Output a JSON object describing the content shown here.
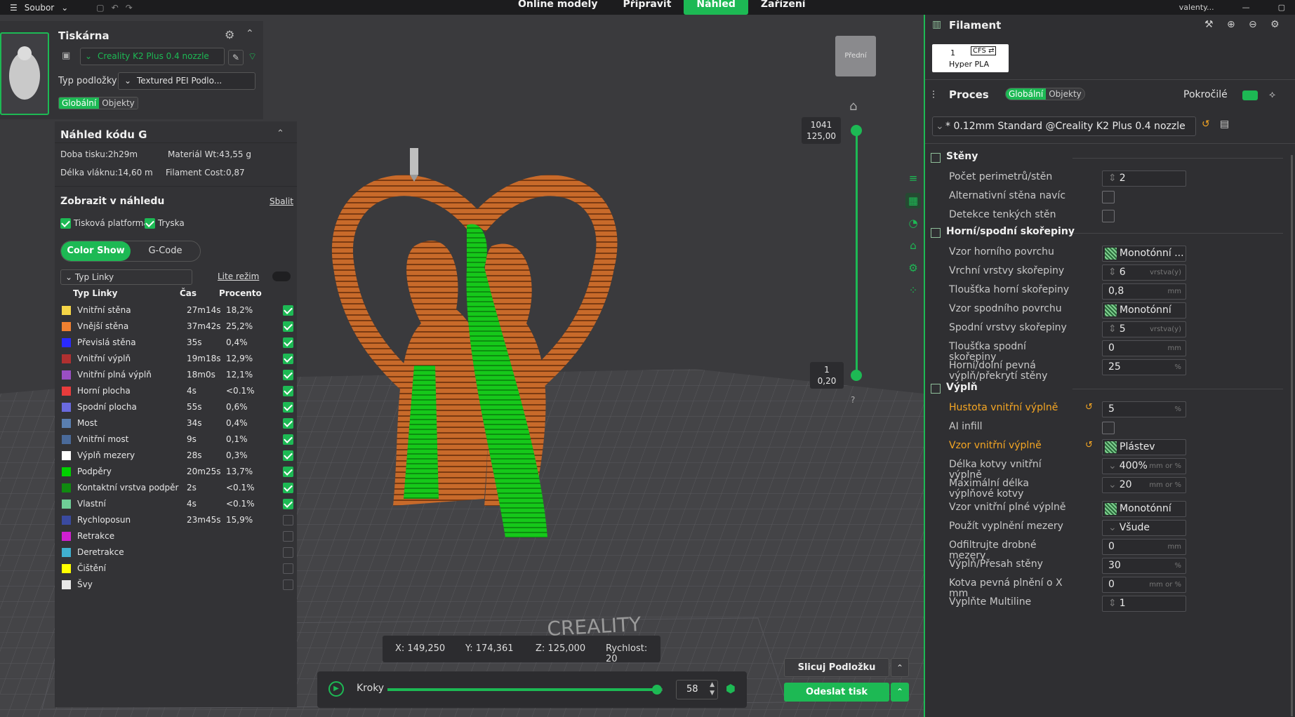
{
  "topbar": {
    "menu_label": "Soubor",
    "tabs": [
      "Online modely",
      "Připravit",
      "Náhled",
      "Zařízení"
    ],
    "active_tab": "Náhled",
    "user": "valenty..."
  },
  "printer": {
    "title": "Tiskárna",
    "printer_name": "Creality K2 Plus 0.4 nozzle",
    "bed_type_label": "Typ podložky",
    "bed_type_value": "Textured PEI Podlo...",
    "scope_global": "Globální",
    "scope_objects": "Objekty"
  },
  "gcode_preview": {
    "title": "Náhled kódu G",
    "print_time": "Doba tisku:2h29m",
    "material_weight": "Materiál Wt:43,55 g",
    "filament_length": "Délka vláknu:14,60 m",
    "filament_cost": "Filament Cost:0,87",
    "show_title": "Zobrazit v náhledu",
    "collapse": "Sbalit",
    "show_platform": "Tisková platforma",
    "show_nozzle": "Tryska",
    "mode_color_show": "Color Show",
    "mode_gcode": "G-Code",
    "line_type_select": "Typ Linky",
    "lite_mode": "Lite režim",
    "col_type": "Typ Linky",
    "col_time": "Čas",
    "col_percent": "Procento",
    "rows": [
      {
        "name": "Vnitřní stěna",
        "time": "27m14s",
        "percent": "18,2%",
        "color": "#f5d547",
        "checked": true
      },
      {
        "name": "Vnější stěna",
        "time": "37m42s",
        "percent": "25,2%",
        "color": "#f08030",
        "checked": true
      },
      {
        "name": "Převislá stěna",
        "time": "35s",
        "percent": "0,4%",
        "color": "#2a2aff",
        "checked": true
      },
      {
        "name": "Vnitřní výplň",
        "time": "19m18s",
        "percent": "12,9%",
        "color": "#b03030",
        "checked": true
      },
      {
        "name": "Vnitřní plná výplň",
        "time": "18m0s",
        "percent": "12,1%",
        "color": "#9a4fc4",
        "checked": true
      },
      {
        "name": "Horní plocha",
        "time": "4s",
        "percent": "<0.1%",
        "color": "#e83c3c",
        "checked": true
      },
      {
        "name": "Spodní plocha",
        "time": "55s",
        "percent": "0,6%",
        "color": "#6a6adf",
        "checked": true
      },
      {
        "name": "Most",
        "time": "34s",
        "percent": "0,4%",
        "color": "#5a7fb0",
        "checked": true
      },
      {
        "name": "Vnitřní most",
        "time": "9s",
        "percent": "0,1%",
        "color": "#4a6a9a",
        "checked": true
      },
      {
        "name": "Výplň mezery",
        "time": "28s",
        "percent": "0,3%",
        "color": "#ffffff",
        "checked": true
      },
      {
        "name": "Podpěry",
        "time": "20m25s",
        "percent": "13,7%",
        "color": "#00d000",
        "checked": true
      },
      {
        "name": "Kontaktní vrstva podpěr",
        "time": "2s",
        "percent": "<0.1%",
        "color": "#108a10",
        "checked": true
      },
      {
        "name": "Vlastní",
        "time": "4s",
        "percent": "<0.1%",
        "color": "#6fcf97",
        "checked": true
      },
      {
        "name": "Rychloposun",
        "time": "23m45s",
        "percent": "15,9%",
        "color": "#3a4aa0",
        "checked": false
      },
      {
        "name": "Retrakce",
        "time": "",
        "percent": "",
        "color": "#d020d0",
        "checked": false
      },
      {
        "name": "Deretrakce",
        "time": "",
        "percent": "",
        "color": "#40b0d0",
        "checked": false
      },
      {
        "name": "Čištění",
        "time": "",
        "percent": "",
        "color": "#ffff00",
        "checked": false
      },
      {
        "name": "Švy",
        "time": "",
        "percent": "",
        "color": "#e8e8e8",
        "checked": false
      }
    ]
  },
  "viewport": {
    "view_cube_label": "Přední",
    "layer_top_a": "1041",
    "layer_top_b": "125,00",
    "layer_bottom_a": "1",
    "layer_bottom_b": "0,20",
    "help": "?",
    "coords": {
      "x": "X: 149,250",
      "y": "Y: 174,361",
      "z": "Z: 125,000",
      "speed": "Rychlost: 20"
    },
    "steps_label": "Kroky",
    "steps_value": "58",
    "steps_fraction": 0.98,
    "slice_plate": "Slicuj Podložku",
    "send_print": "Odeslat tisk"
  },
  "filament": {
    "title": "Filament",
    "slot": "1",
    "cfs_label": "CFS",
    "material": "Hyper PLA"
  },
  "process": {
    "title": "Proces",
    "scope_global": "Globální",
    "scope_objects": "Objekty",
    "advanced": "Pokročilé",
    "preset": "* 0.12mm Standard @Creality K2 Plus 0.4 nozzle",
    "sections": {
      "walls": "Stěny",
      "shells": "Horní/spodní skořepiny",
      "infill": "Výplň"
    },
    "walls_rows": [
      {
        "label": "Počet perimetrů/stěn",
        "type": "spin",
        "value": "2",
        "unit": ""
      },
      {
        "label": "Alternativní stěna navíc",
        "type": "check"
      },
      {
        "label": "Detekce tenkých stěn",
        "type": "check"
      }
    ],
    "shell_rows": [
      {
        "label": "Vzor horního povrchu",
        "type": "pattern",
        "value": "Monotónní ..."
      },
      {
        "label": "Vrchní vrstvy skořepiny",
        "type": "spin",
        "value": "6",
        "unit": "vrstva(y)"
      },
      {
        "label": "Tloušťka horní skořepiny",
        "type": "text",
        "value": "0,8",
        "unit": "mm"
      },
      {
        "label": "Vzor spodního povrchu",
        "type": "pattern",
        "value": "Monotónní"
      },
      {
        "label": "Spodní vrstvy skořepiny",
        "type": "spin",
        "value": "5",
        "unit": "vrstva(y)"
      },
      {
        "label": "Tloušťka spodní skořepiny",
        "type": "text",
        "value": "0",
        "unit": "mm"
      },
      {
        "label": "Horní/dolní pevná výplň/překrytí stěny",
        "type": "text",
        "value": "25",
        "unit": "%"
      }
    ],
    "infill_rows": [
      {
        "label": "Hustota vnitřní výplně",
        "type": "text",
        "value": "5",
        "unit": "%",
        "highlight": true
      },
      {
        "label": "AI infill",
        "type": "check"
      },
      {
        "label": "Vzor vnitřní výplně",
        "type": "pattern",
        "value": "Plástev",
        "highlight": true
      },
      {
        "label": "Délka kotvy vnitřní výplně",
        "type": "drop",
        "value": "400%",
        "unit": "mm or %"
      },
      {
        "label": "Maximální délka výplňové kotvy",
        "type": "drop",
        "value": "20",
        "unit": "mm or %"
      },
      {
        "label": "Vzor vnitřní plné výplně",
        "type": "pattern",
        "value": "Monotónní"
      },
      {
        "label": "Použít vyplnění mezery",
        "type": "drop",
        "value": "Všude",
        "unit": ""
      },
      {
        "label": "Odfiltrujte drobné mezery",
        "type": "text",
        "value": "0",
        "unit": "mm"
      },
      {
        "label": "Výplň/Přesah stěny",
        "type": "text",
        "value": "30",
        "unit": "%"
      },
      {
        "label": "Kotva pevná plnění o X mm",
        "type": "text",
        "value": "0",
        "unit": "mm or %"
      },
      {
        "label": "Vyplňte Multiline",
        "type": "spin",
        "value": "1",
        "unit": ""
      }
    ]
  }
}
